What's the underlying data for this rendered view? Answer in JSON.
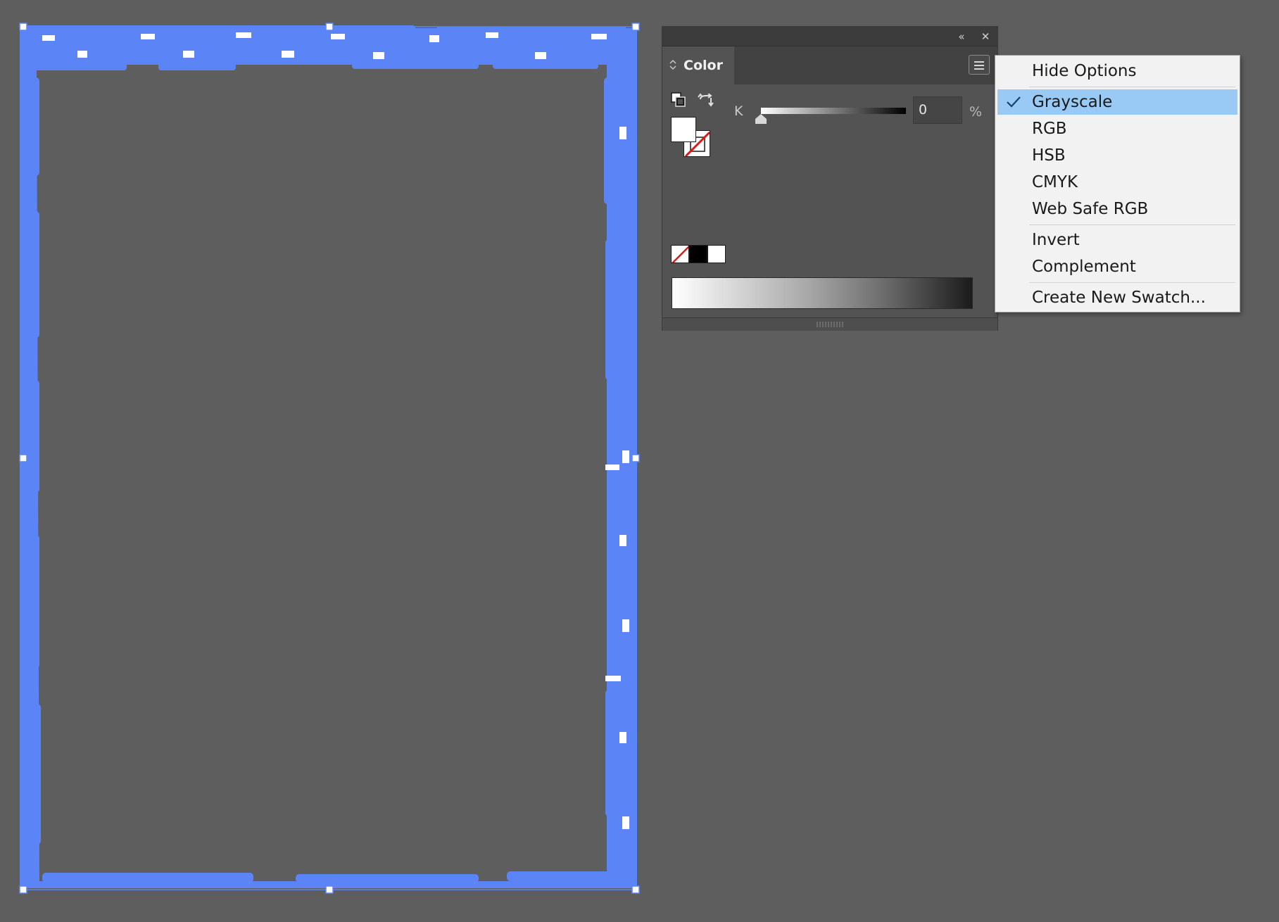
{
  "canvas": {
    "selection_color": "#5b84f7",
    "artboard_fill": "#ffffff",
    "background": "#5e5e5e"
  },
  "color_panel": {
    "tab_label": "Color",
    "collapse_glyph": "«",
    "close_glyph": "✕",
    "slider": {
      "label": "K",
      "value": "0",
      "unit": "%",
      "level": 0
    },
    "icons": {
      "collapse": "double-chevron-left-icon",
      "close": "close-icon",
      "menu": "hamburger-menu-icon",
      "default_fill_stroke": "default-fill-stroke-icon",
      "swap": "swap-fill-stroke-icon"
    }
  },
  "flyout_menu": {
    "items": [
      {
        "label": "Hide Options",
        "checked": false,
        "selected": false
      },
      {
        "label": "Grayscale",
        "checked": true,
        "selected": true
      },
      {
        "label": "RGB",
        "checked": false,
        "selected": false
      },
      {
        "label": "HSB",
        "checked": false,
        "selected": false
      },
      {
        "label": "CMYK",
        "checked": false,
        "selected": false
      },
      {
        "label": "Web Safe RGB",
        "checked": false,
        "selected": false
      },
      {
        "label": "Invert",
        "checked": false,
        "selected": false
      },
      {
        "label": "Complement",
        "checked": false,
        "selected": false
      },
      {
        "label": "Create New Swatch...",
        "checked": false,
        "selected": false
      }
    ],
    "highlight_color": "#99c9f5"
  }
}
